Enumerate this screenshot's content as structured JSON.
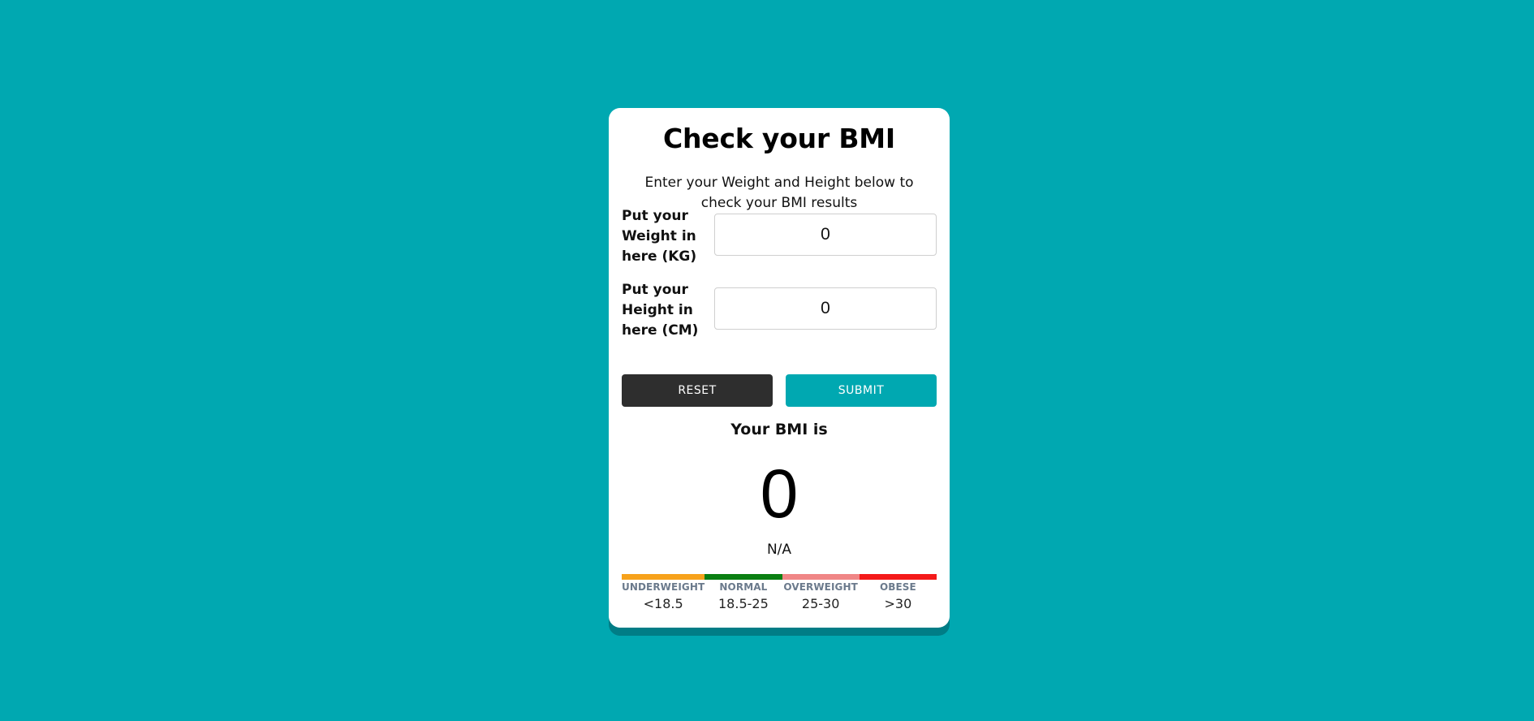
{
  "page": {
    "background_color": "#00a8b1"
  },
  "card": {
    "title": "Check your BMI",
    "subtitle": "Enter your Weight and Height below to check your BMI results"
  },
  "form": {
    "weight": {
      "label": "Put your Weight in here (KG)",
      "value": "0"
    },
    "height": {
      "label": "Put your Height in here (CM)",
      "value": "0"
    },
    "reset_label": "RESET",
    "submit_label": "SUBMIT"
  },
  "result": {
    "label": "Your BMI is",
    "value": "0",
    "category": "N/A"
  },
  "scale": [
    {
      "name": "UNDERWEIGHT",
      "range": "<18.5",
      "color": "#f7a21b"
    },
    {
      "name": "NORMAL",
      "range": "18.5-25",
      "color": "#0a7f12"
    },
    {
      "name": "OVERWEIGHT",
      "range": "25-30",
      "color": "#f08686"
    },
    {
      "name": "OBESE",
      "range": ">30",
      "color": "#f41a1a"
    }
  ]
}
